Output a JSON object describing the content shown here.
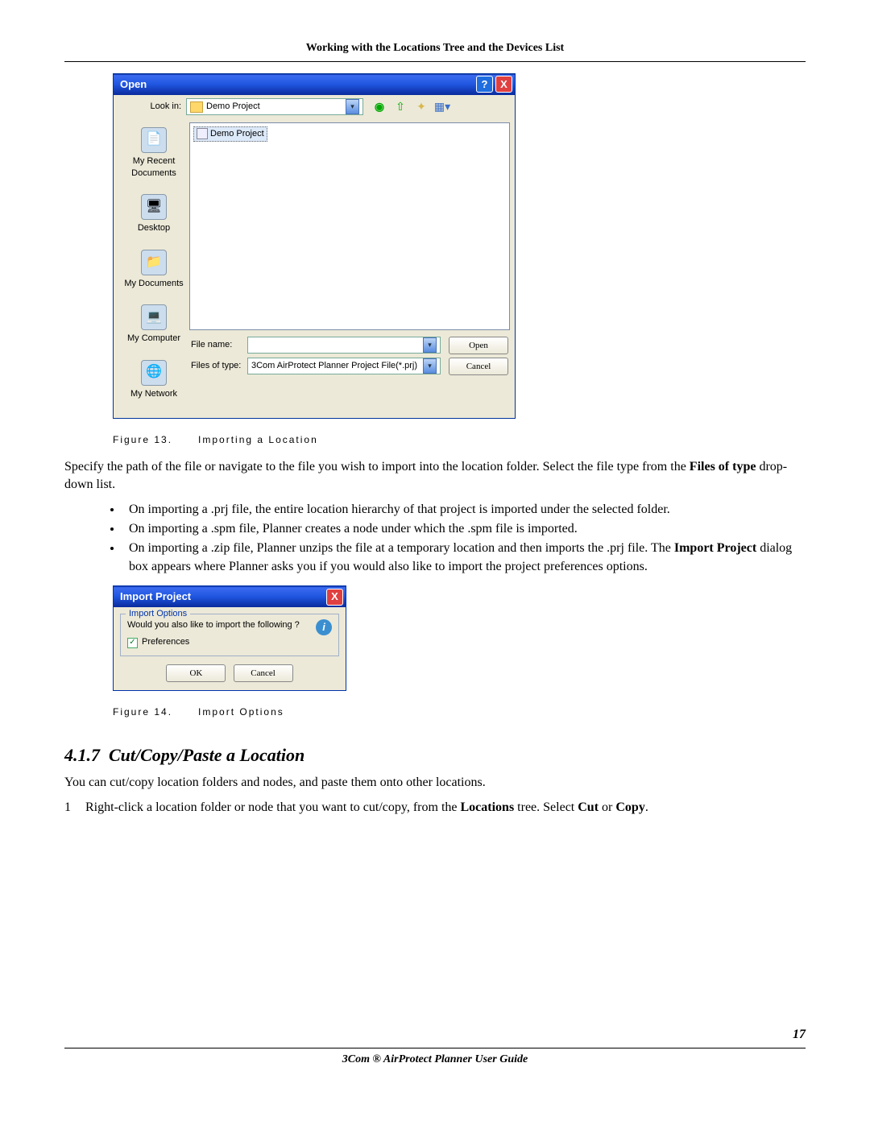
{
  "header": "Working with the Locations Tree and the Devices List",
  "open_dialog": {
    "title": "Open",
    "look_in_label": "Look in:",
    "look_in_value": "Demo Project",
    "places": [
      {
        "label": "My Recent Documents",
        "glyph": "📄"
      },
      {
        "label": "Desktop",
        "glyph": "🖥"
      },
      {
        "label": "My Documents",
        "glyph": "📁"
      },
      {
        "label": "My Computer",
        "glyph": "💻"
      },
      {
        "label": "My Network",
        "glyph": "🌐"
      }
    ],
    "file_item": "Demo Project",
    "file_name_label": "File name:",
    "file_name_value": "",
    "files_type_label": "Files of type:",
    "files_type_value": "3Com AirProtect Planner Project File(*.prj)",
    "open_btn": "Open",
    "cancel_btn": "Cancel"
  },
  "figure13": {
    "label": "Figure 13.",
    "caption": "Importing a Location"
  },
  "paragraph1_a": "Specify the path of the file or navigate to the file you wish to import into the location folder. Select the file type from the ",
  "paragraph1_b": "Files of type",
  "paragraph1_c": " drop-down list.",
  "bullets": [
    "On importing a .prj file, the entire location hierarchy of that project is imported under the selected folder.",
    "On importing a .spm file, Planner creates a node under which the .spm file is imported."
  ],
  "bullet3_a": "On importing a .zip file, Planner unzips the file at a temporary location and then imports the .prj file. The ",
  "bullet3_b": "Import Project",
  "bullet3_c": " dialog box appears where Planner asks you if you would also like to import the project preferences options.",
  "import_dialog": {
    "title": "Import Project",
    "legend": "Import Options",
    "question": "Would you also like to import the following ?",
    "checkbox_label": "Preferences",
    "ok": "OK",
    "cancel": "Cancel"
  },
  "figure14": {
    "label": "Figure 14.",
    "caption": "Import Options"
  },
  "section": {
    "number": "4.1.7",
    "title": "Cut/Copy/Paste a Location"
  },
  "section_intro": "You can cut/copy location folders and nodes, and paste them onto other locations.",
  "step1_num": "1",
  "step1_a": "Right-click a location folder or node that you want to cut/copy, from the ",
  "step1_b": "Locations",
  "step1_c": " tree. Select ",
  "step1_d": "Cut",
  "step1_e": " or ",
  "step1_f": "Copy",
  "step1_g": ".",
  "page_number": "17",
  "footer": "3Com ® AirProtect Planner User Guide"
}
